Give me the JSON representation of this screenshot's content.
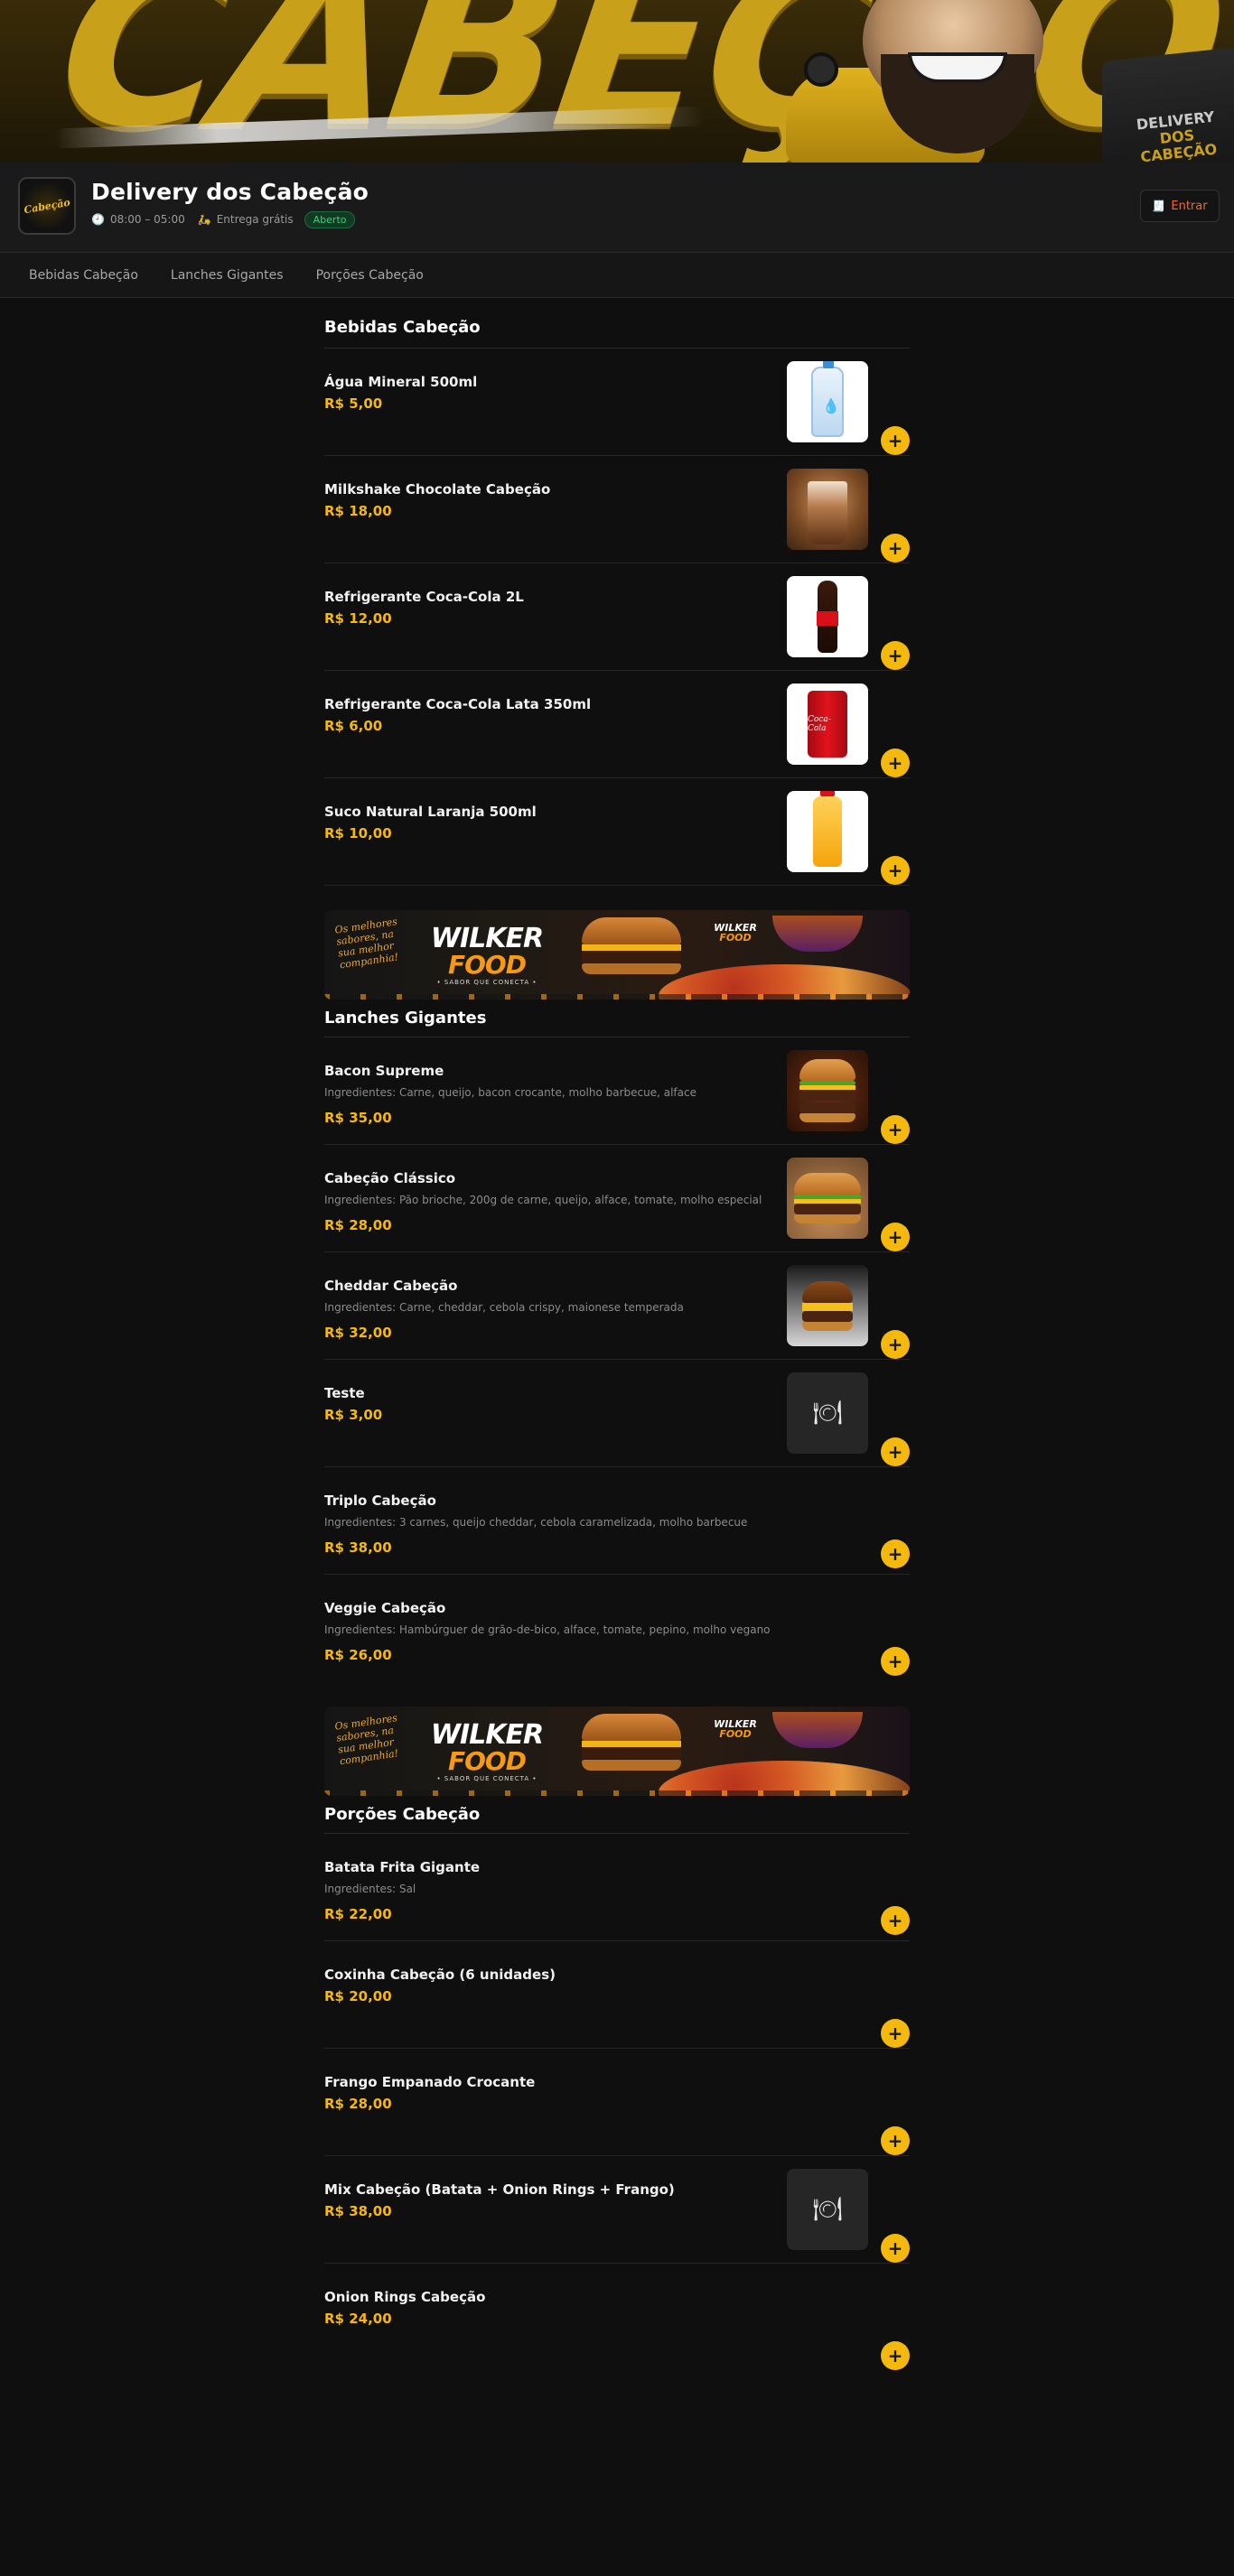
{
  "hero": {
    "word": "CABEÇÃO",
    "box_line1": "DELIVERY",
    "box_line2": "DOS",
    "box_line3": "CABEÇÃO"
  },
  "store": {
    "logo_text": "Cabeção",
    "name": "Delivery dos Cabeção",
    "hours": "08:00 – 05:00",
    "delivery": "Entrega grátis",
    "status": "Aberto",
    "login_label": "Entrar",
    "icons": {
      "clock": "clock-icon",
      "delivery": "scooter-icon",
      "login": "receipt-icon"
    }
  },
  "nav": {
    "tabs": [
      "Bebidas Cabeção",
      "Lanches Gigantes",
      "Porções Cabeção"
    ]
  },
  "colors": {
    "accent": "#f5b80c",
    "status_green": "#39d07a",
    "login_orange": "#f06a2a",
    "background": "#0f0f0f"
  },
  "promo": {
    "slogan": "Os melhores sabores, na sua melhor companhia!",
    "brand_top": "WILKER",
    "brand_bottom": "FOOD",
    "tagline": "• SABOR QUE CONECTA •",
    "mini_brand_top": "WILKER",
    "mini_brand_bottom": "FOOD"
  },
  "sections": [
    {
      "title": "Bebidas Cabeção",
      "items": [
        {
          "name": "Água Mineral 500ml",
          "price": "R$ 5,00"
        },
        {
          "name": "Milkshake Chocolate Cabeção",
          "price": "R$ 18,00"
        },
        {
          "name": "Refrigerante Coca-Cola 2L",
          "price": "R$ 12,00"
        },
        {
          "name": "Refrigerante Coca-Cola Lata 350ml",
          "price": "R$ 6,00",
          "can_text": "Coca-Cola"
        },
        {
          "name": "Suco Natural Laranja 500ml",
          "price": "R$ 10,00"
        }
      ]
    },
    {
      "title": "Lanches Gigantes",
      "items": [
        {
          "name": "Bacon Supreme",
          "desc": "Ingredientes: Carne, queijo, bacon crocante, molho barbecue, alface",
          "price": "R$ 35,00"
        },
        {
          "name": "Cabeção Clássico",
          "desc": "Ingredientes: Pão brioche, 200g de carne, queijo, alface, tomate, molho especial",
          "price": "R$ 28,00"
        },
        {
          "name": "Cheddar Cabeção",
          "desc": "Ingredientes: Carne, cheddar, cebola crispy, maionese temperada",
          "price": "R$ 32,00"
        },
        {
          "name": "Teste",
          "price": "R$ 3,00"
        },
        {
          "name": "Triplo Cabeção",
          "desc": "Ingredientes: 3 carnes, queijo cheddar, cebola caramelizada, molho barbecue",
          "price": "R$ 38,00"
        },
        {
          "name": "Veggie Cabeção",
          "desc": "Ingredientes: Hambúrguer de grão-de-bico, alface, tomate, pepino, molho vegano",
          "price": "R$ 26,00"
        }
      ]
    },
    {
      "title": "Porções Cabeção",
      "items": [
        {
          "name": "Batata Frita Gigante",
          "desc": "Ingredientes: Sal",
          "price": "R$ 22,00"
        },
        {
          "name": "Coxinha Cabeção (6 unidades)",
          "price": "R$ 20,00"
        },
        {
          "name": "Frango Empanado Crocante",
          "price": "R$ 28,00"
        },
        {
          "name": "Mix Cabeção (Batata + Onion Rings + Frango)",
          "price": "R$ 38,00"
        },
        {
          "name": "Onion Rings Cabeção",
          "price": "R$ 24,00"
        }
      ]
    }
  ],
  "ui": {
    "add_symbol": "+",
    "placeholder_icon": "🍽"
  }
}
